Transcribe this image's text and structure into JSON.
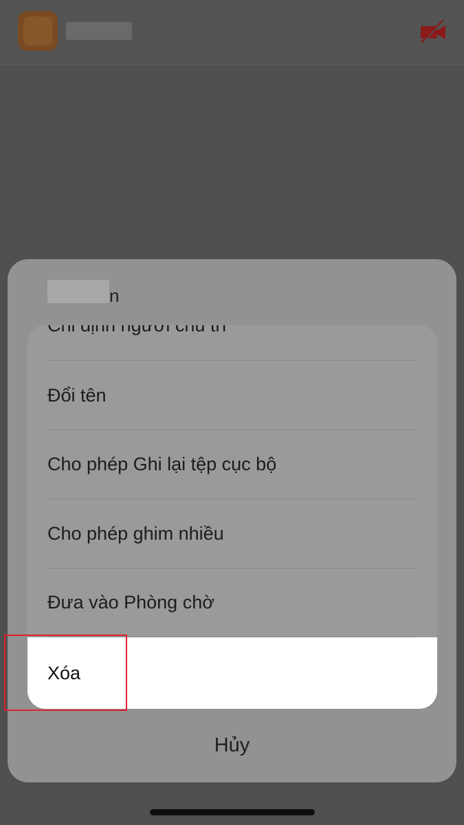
{
  "header": {
    "video_icon": "video-off-icon"
  },
  "sheet": {
    "title_tail": "n",
    "options": {
      "partial_label": "Chỉ định người chủ trì",
      "rename_label": "Đổi tên",
      "record_label": "Cho phép Ghi lại tệp cục bộ",
      "pin_label": "Cho phép ghim nhiều",
      "waiting_room_label": "Đưa vào Phòng chờ",
      "remove_label": "Xóa"
    },
    "cancel_label": "Hủy"
  },
  "colors": {
    "highlight": "#e0202e",
    "video_icon": "#8b1a1a"
  }
}
